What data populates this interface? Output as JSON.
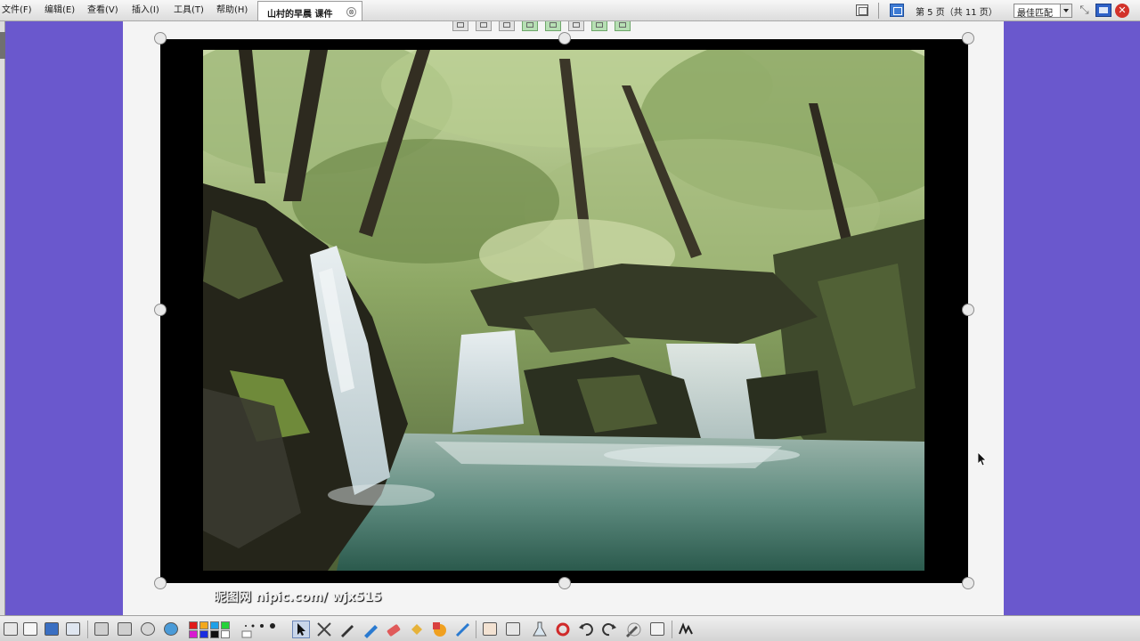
{
  "menu": {
    "file": "文件(F)",
    "edit": "编辑(E)",
    "view": "查看(V)",
    "insert": "插入(I)",
    "tools": "工具(T)",
    "help": "帮助(H)"
  },
  "document_tab": {
    "title": "山村的早晨  课件",
    "close_symbol": "⊗"
  },
  "page_indicator": "第 5 页（共 11 页）",
  "zoom": {
    "selected": "最佳匹配"
  },
  "window_controls": {
    "fullscreen_symbol": "⤡",
    "close_symbol": "✕"
  },
  "photo": {
    "watermark": "昵图网 nipic.com/ wjx515",
    "description_icon": "waterfall-forest-photo"
  },
  "colors": {
    "panel_purple": "#6a58cd",
    "canvas": "#f4f4f4",
    "close_red": "#d2322a",
    "accent_blue": "#3e7bd4"
  },
  "palette": [
    "#e01b1b",
    "#f2a81d",
    "#1ea0e8",
    "#26d23a",
    "#d81bd0",
    "#1b2ee0",
    "#f0e21d",
    "#111111",
    "#ffffff"
  ],
  "bottom_toolbar_icons": [
    "start-menu-icon",
    "notes-icon",
    "gallery-icon",
    "tools-icon",
    "previous-page-icon",
    "next-page-icon",
    "record-icon",
    "browser-icon",
    "color-palette",
    "line-width-icon",
    "select-cursor-icon",
    "shape-recognition-icon",
    "pen-icon",
    "highlighter-icon",
    "eraser-icon",
    "fill-icon",
    "shapes-icon",
    "magic-pen-icon",
    "screen-capture-icon",
    "recorder-icon",
    "flask-icon",
    "redo-loop-icon",
    "undo-icon",
    "redo-icon",
    "edit-icon",
    "keyboard-icon",
    "recognize-icon"
  ]
}
